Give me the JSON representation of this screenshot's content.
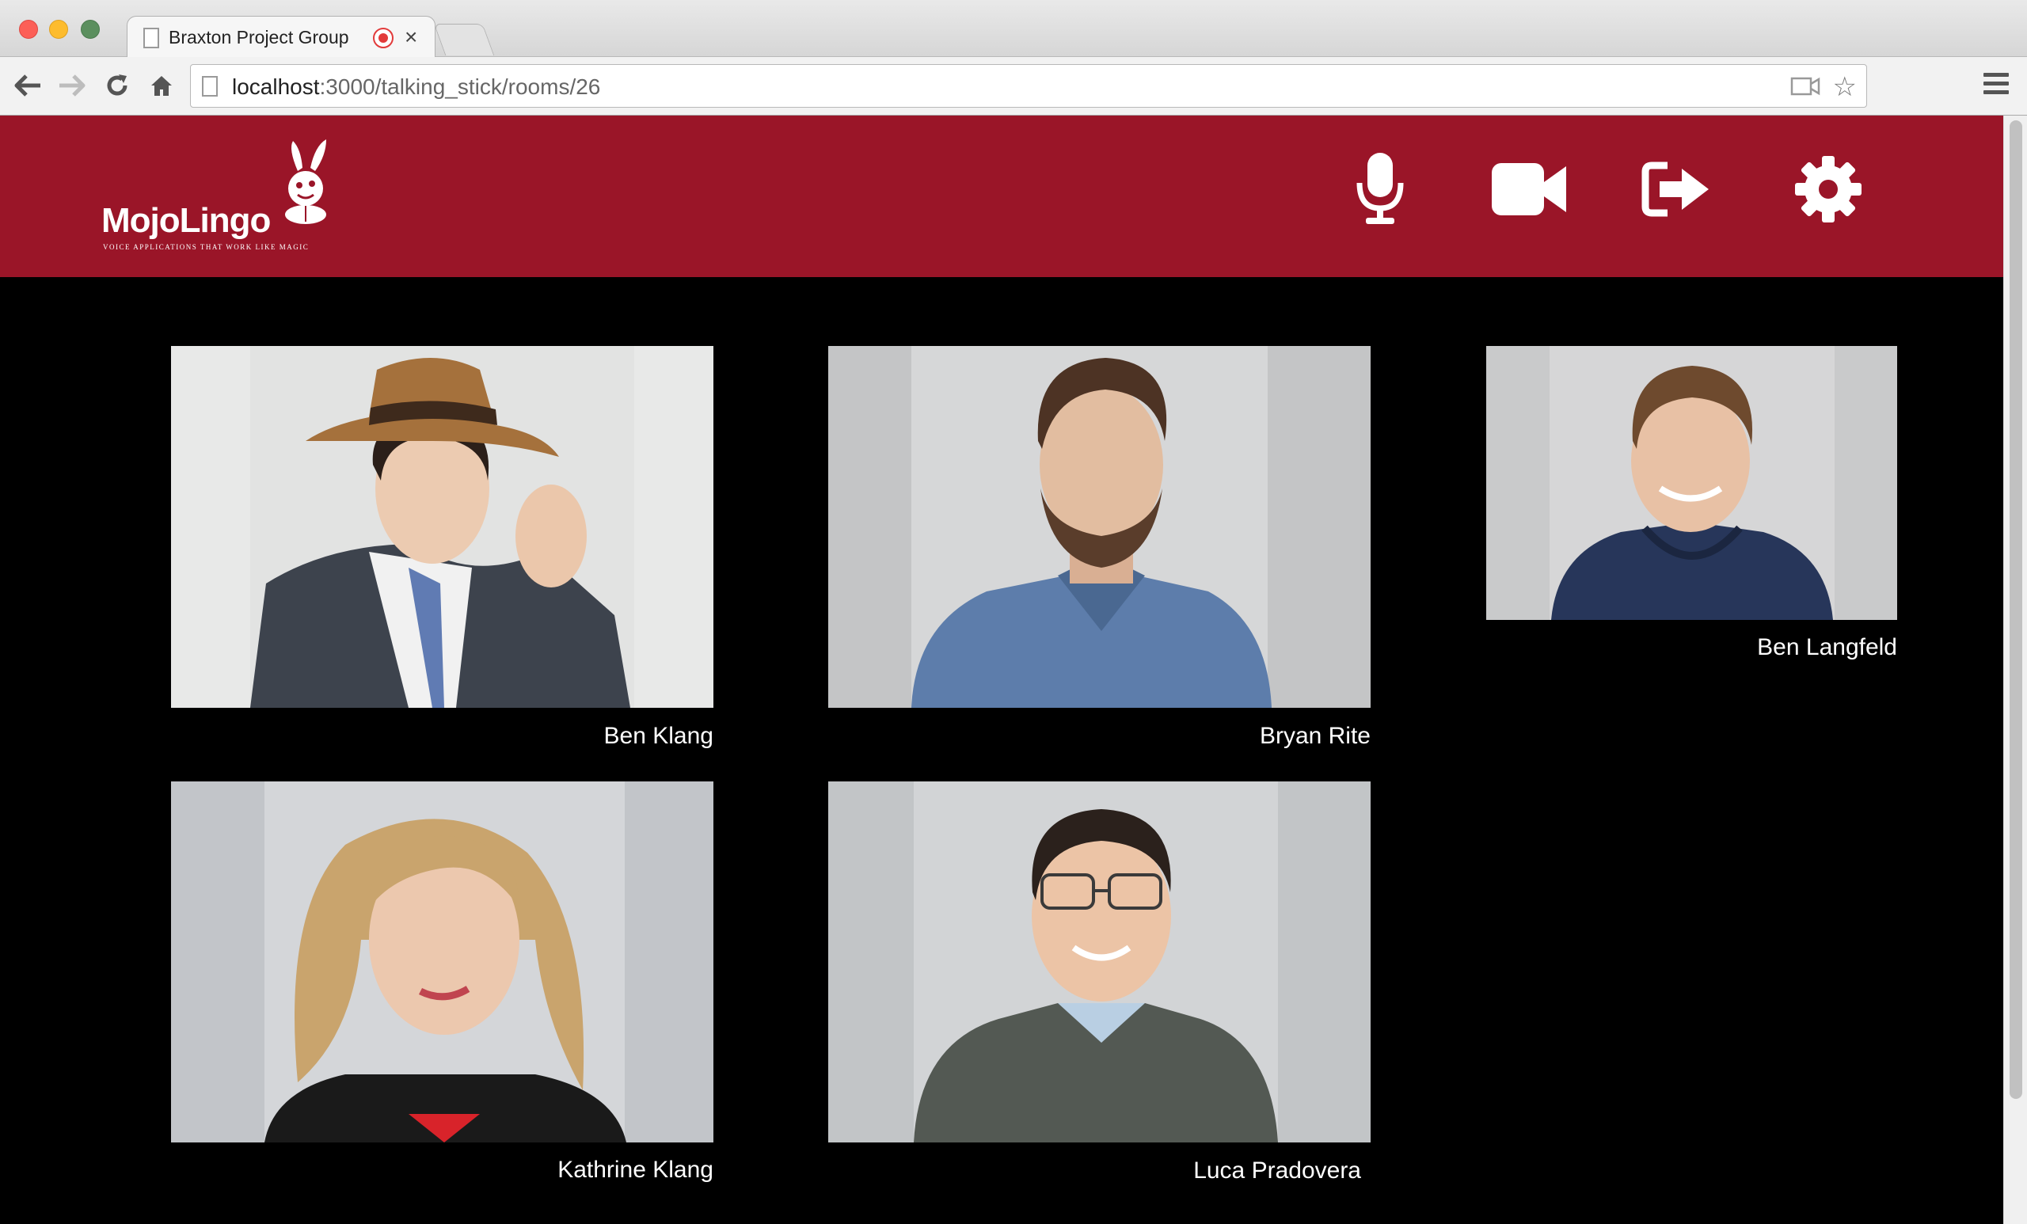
{
  "browser": {
    "tab_title": "Braxton Project Group",
    "tab_close": "×",
    "url_host": "localhost",
    "url_path": ":3000/talking_stick/rooms/26",
    "star": "☆"
  },
  "app": {
    "logo_text": "MojoLingo",
    "logo_tagline": "VOICE APPLICATIONS THAT WORK LIKE MAGIC",
    "header_color": "#9a1528",
    "controls": [
      "microphone-icon",
      "video-camera-icon",
      "leave-room-icon",
      "settings-gear-icon"
    ]
  },
  "participants": [
    {
      "name": "Ben Klang"
    },
    {
      "name": "Bryan Rite"
    },
    {
      "name": "Ben Langfeld"
    },
    {
      "name": "Kathrine Klang"
    },
    {
      "name": "Luca Pradovera"
    }
  ]
}
